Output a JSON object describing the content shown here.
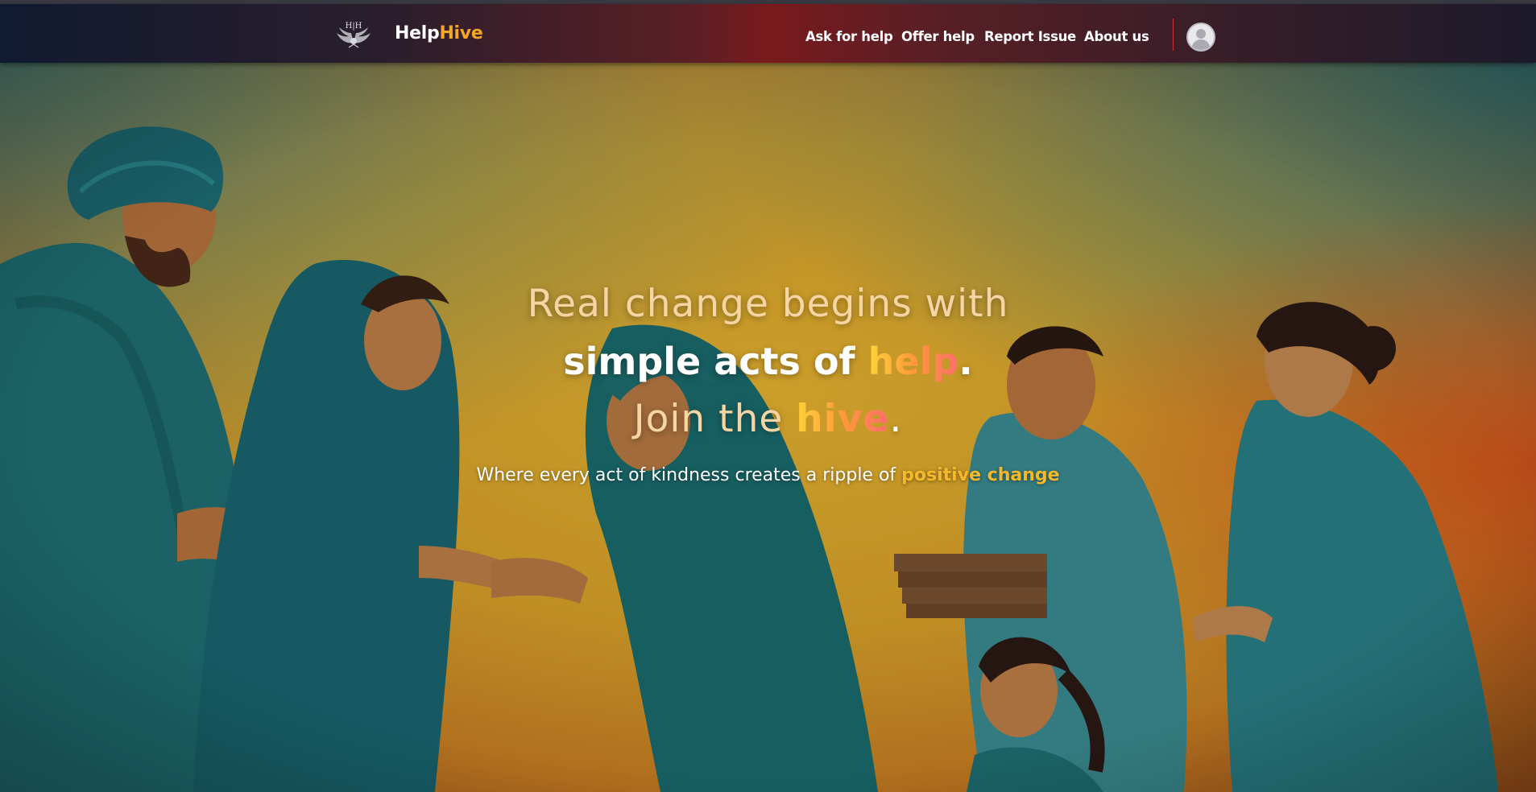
{
  "navbar": {
    "brand_part1": "Help",
    "brand_part2": "Hive",
    "logo_text": "H|H",
    "links": [
      {
        "label": "Ask for help"
      },
      {
        "label": "Offer help"
      },
      {
        "label": "Report Issue"
      },
      {
        "label": "About us"
      }
    ],
    "avatar_icon": "user-avatar-icon"
  },
  "hero": {
    "line1": "Real change begins with",
    "line2_prefix": "simple acts of ",
    "line2_highlight": "help",
    "line2_suffix": ".",
    "line3_prefix": "Join the ",
    "line3_highlight": "hive",
    "line3_suffix": ".",
    "subtitle_prefix": "Where every act of kindness creates a ripple of ",
    "subtitle_highlight": "positive change"
  },
  "colors": {
    "accent": "#f5a623",
    "highlight_gradient_start": "#ffd23a",
    "highlight_gradient_end": "#ff6e6e",
    "hero_text_light": "#f6d5a4"
  }
}
